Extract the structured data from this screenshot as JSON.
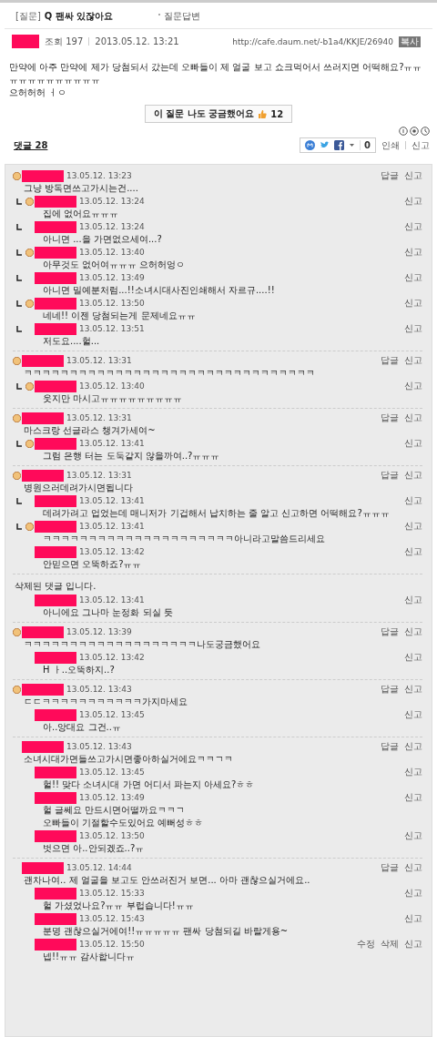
{
  "header": {
    "prefix": "[질문]",
    "title": "Q 팬싸 있잖아요",
    "category": "질문답변"
  },
  "meta": {
    "views": "조회 197",
    "date": "2013.05.12. 13:21",
    "url": "http://cafe.daum.net/-b1a4/KKJE/26940",
    "copy": "복사"
  },
  "body": [
    "만약에 아주 만약에 제가 당첨되서 갔는데 오빠들이 제 얼굴 보고 쇼크먹어서 쓰러지면 어떡해요?ㅠㅠㅠㅠㅠㅠㅠㅠㅠㅠㅠㅠ",
    "으허허허 ㅓㅇ"
  ],
  "like_button": {
    "label": "이 질문 나도 궁금했어요",
    "count": "12"
  },
  "comments_link": "댓글 28",
  "share": {
    "count": "0"
  },
  "tools": [
    "인쇄",
    "신고"
  ],
  "threads": [
    {
      "kind": "comment",
      "comment": {
        "avatar": true,
        "time": "13.05.12. 13:23",
        "text": "그냥 방독면쓰고가시는건....",
        "actions": [
          "답글",
          "신고"
        ]
      },
      "replies": [
        {
          "mark": true,
          "avatar": true,
          "time": "13.05.12. 13:24",
          "text": "집에 없어요ㅠㅠㅠ",
          "actions": [
            "신고"
          ]
        },
        {
          "mark": true,
          "avatar": false,
          "time": "13.05.12. 13:24",
          "text": "아니면 ...을 가면없으세여...?",
          "actions": [
            "신고"
          ]
        },
        {
          "mark": true,
          "avatar": true,
          "time": "13.05.12. 13:40",
          "text": "아무것도 없어여ㅠㅠㅠ 으허허엉ㅇ",
          "actions": [
            "신고"
          ]
        },
        {
          "mark": true,
          "avatar": false,
          "time": "13.05.12. 13:49",
          "text": "아니면 밀예분처럼...!!소녀시대사진인쇄해서 자르규....!!",
          "actions": [
            "신고"
          ]
        },
        {
          "mark": true,
          "avatar": true,
          "time": "13.05.12. 13:50",
          "text": "네네!! 이젠 당첨되는게 문제네요ㅠㅠ",
          "actions": [
            "신고"
          ]
        },
        {
          "mark": true,
          "avatar": false,
          "time": "13.05.12. 13:51",
          "text": "저도요....헐...",
          "actions": [
            "신고"
          ]
        }
      ]
    },
    {
      "kind": "comment",
      "comment": {
        "avatar": true,
        "time": "13.05.12. 13:31",
        "text": "ㅋㅋㅋㅋㅋㅋㅋㅋㅋㅋㅋㅋㅋㅋㅋㅋㅋㅋㅋㅋㅋㅋㅋㅋㅋㅋㅋㅋㅋㅋㅋㅋ",
        "actions": [
          "답글",
          "신고"
        ]
      },
      "replies": [
        {
          "mark": true,
          "avatar": true,
          "time": "13.05.12. 13:40",
          "text": "웃지만 마시고ㅠㅠㅠㅠㅠㅠㅠㅠㅠ",
          "actions": [
            "신고"
          ]
        }
      ]
    },
    {
      "kind": "comment",
      "comment": {
        "avatar": true,
        "time": "13.05.12. 13:31",
        "text": "마스크랑 선글라스 챙겨가세여~",
        "actions": [
          "답글",
          "신고"
        ]
      },
      "replies": [
        {
          "mark": true,
          "avatar": true,
          "time": "13.05.12. 13:41",
          "text": "그럼 은행 터는 도둑같지 않을까여..?ㅠㅠㅠ",
          "actions": [
            "신고"
          ]
        }
      ]
    },
    {
      "kind": "comment",
      "comment": {
        "avatar": true,
        "time": "13.05.12. 13:31",
        "text": "병원으러데려가시면됩니다",
        "actions": [
          "답글",
          "신고"
        ]
      },
      "replies": [
        {
          "mark": true,
          "avatar": false,
          "time": "13.05.12. 13:41",
          "text": "데려가려고 업었는데 매니저가 기겁해서 납치하는 줄 알고 신고하면 어떡해요?ㅠㅠㅠ",
          "actions": [
            "신고"
          ]
        },
        {
          "mark": true,
          "avatar": true,
          "time": "13.05.12. 13:41",
          "text": "ㅋㅋㅋㅋㅋㅋㅋㅋㅋㅋㅋㅋㅋㅋㅋㅋㅋㅋㅋㅋㅋ아니라고말씀드리세요",
          "actions": [
            "신고"
          ]
        },
        {
          "mark": false,
          "avatar": false,
          "time": "13.05.12. 13:42",
          "text": "안믿으면 오뚝하죠?ㅠㅠ",
          "actions": [
            "신고"
          ]
        }
      ]
    },
    {
      "kind": "deleted",
      "notice": "삭제된 댓글 입니다.",
      "replies": [
        {
          "mark": false,
          "avatar": false,
          "time": "13.05.12. 13:41",
          "text": "아니에요 그나마 눈정화 되실 듯",
          "actions": [
            "신고"
          ]
        }
      ]
    },
    {
      "kind": "comment",
      "comment": {
        "avatar": true,
        "time": "13.05.12. 13:39",
        "text": "ㅋㅋㅋㅋㅋㅋㅋㅋㅋㅋㅋㅋㅋㅋㅋㅋㅋㅋㅋ나도궁금했어요",
        "actions": [
          "답글",
          "신고"
        ]
      },
      "replies": [
        {
          "mark": false,
          "avatar": false,
          "time": "13.05.12. 13:42",
          "text": "H ㅏ..오뚝하지..?",
          "actions": [
            "신고"
          ]
        }
      ]
    },
    {
      "kind": "comment",
      "comment": {
        "avatar": true,
        "time": "13.05.12. 13:43",
        "text": "ㄷㄷㅋㅋㅋㅋㅋㅋㅋㅋㅋㅋㅋ가지마세요",
        "actions": [
          "답글",
          "신고"
        ]
      },
      "replies": [
        {
          "mark": false,
          "avatar": false,
          "time": "13.05.12. 13:45",
          "text": "아..앙대요 그건..ㅠ",
          "actions": [
            "신고"
          ]
        }
      ]
    },
    {
      "kind": "comment",
      "comment": {
        "avatar": false,
        "time": "13.05.12. 13:43",
        "text": "소녀시대가면들쓰고가시면좋아하실거에요ㅋㅋㄱㅋ",
        "actions": [
          "답글",
          "신고"
        ]
      },
      "replies": [
        {
          "mark": false,
          "avatar": false,
          "time": "13.05.12. 13:45",
          "text": "헐!! 맞다 소녀시대 가면 어디서 파는지 아세요?ㅎㅎ",
          "actions": [
            "신고"
          ]
        },
        {
          "mark": false,
          "avatar": false,
          "time": "13.05.12. 13:49",
          "text": "헐 글쎄요 만드시면어떨까요ㅋㅋㄱ\n오빠들이 기절할수도있어요 예뻐성ㅎㅎ",
          "actions": [
            "신고"
          ]
        },
        {
          "mark": false,
          "avatar": false,
          "time": "13.05.12. 13:50",
          "text": "벗으면 아..안되겠죠..?ㅠ",
          "actions": [
            "신고"
          ]
        }
      ]
    },
    {
      "kind": "comment",
      "comment": {
        "avatar": false,
        "time": "13.05.12. 14:44",
        "text": "괜차나여.. 제 얼굴을 보고도 안쓰러진거 보면... 아마 괜찮으실거에요..",
        "actions": [
          "답글",
          "신고"
        ]
      },
      "replies": [
        {
          "mark": false,
          "avatar": false,
          "time": "13.05.12. 15:33",
          "text": "헐 가셨었나요?ㅠㅠ 부럽습니다!ㅠㅠ",
          "actions": [
            "신고"
          ]
        },
        {
          "mark": false,
          "avatar": false,
          "time": "13.05.12. 15:43",
          "text": "분명 괜찮으실거에여!!ㅠㅠㅠㅠㅠ 팬싸 당첨되길 바랄게용~",
          "actions": [
            "신고"
          ]
        },
        {
          "mark": false,
          "avatar": false,
          "time": "13.05.12. 15:50",
          "text": "넵!!ㅠㅠ 감사합니다ㅠ",
          "actions": [
            "수정",
            "삭제",
            "신고"
          ]
        }
      ]
    }
  ]
}
